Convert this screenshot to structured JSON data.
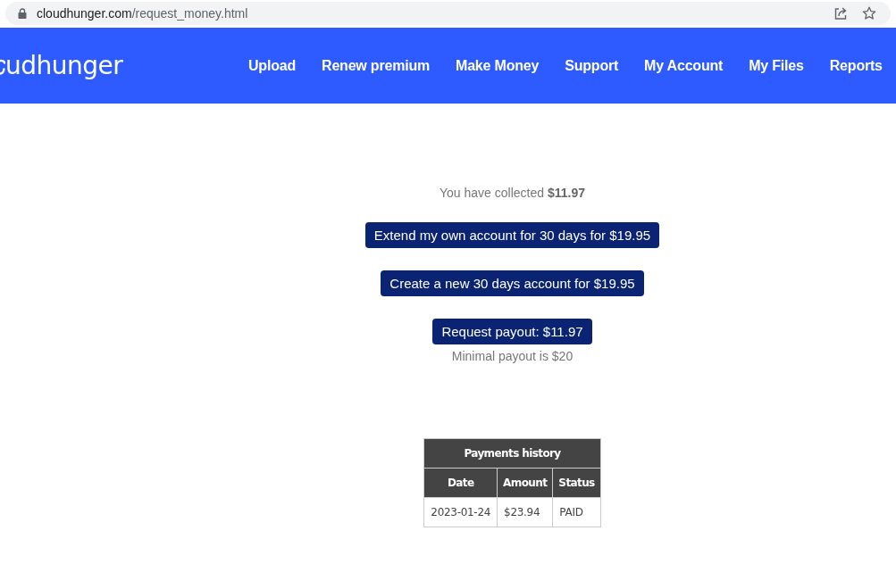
{
  "browser": {
    "url_host": "cloudhunger.com",
    "url_path": "/request_money.html"
  },
  "header": {
    "logo": "udhunger",
    "nav": [
      "Upload",
      "Renew premium",
      "Make Money",
      "Support",
      "My Account",
      "My Files",
      "Reports"
    ]
  },
  "collected": "You have collected **$11.97**",
  "buttons": [
    "Extend my own account for 30 days for $19.95",
    "Create a new 30 days account for $19.95",
    "Request payout: $11.97"
  ],
  "payout_note": "Minimal payout is $20",
  "payments": {
    "title": "Payments history",
    "columns": [
      "Date",
      "Amount",
      "Status"
    ],
    "rows": [
      [
        "2023-01-24",
        "$23.94",
        "PAID"
      ]
    ]
  }
}
